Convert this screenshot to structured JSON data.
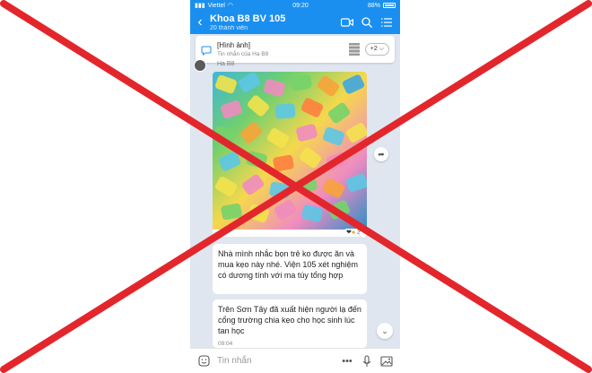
{
  "status": {
    "carrier": "Viettel",
    "time": "09:20",
    "battery": "88%"
  },
  "header": {
    "title": "Khoa B8 BV 105",
    "subtitle": "20 thành viên"
  },
  "pinned": {
    "title": "[Hình ảnh]",
    "sub": "Tin nhắn của Ha B8",
    "more": "+2 ⌵"
  },
  "message": {
    "sender": "Ha B8",
    "reactions": "3",
    "text1": "Nhà mình nhắc bọn trẻ ko được ăn và mua kẹo này nhé. Viện 105 xét nghiệm có dương tính với ma túy tổng hợp",
    "text2": "Trên Sơn Tây đã xuất hiện người lạ đến cổng trường chia kẹo cho học sinh lúc tan học",
    "time2": "09:04"
  },
  "input": {
    "placeholder": "Tin nhắn"
  },
  "colors": {
    "accent": "#1a8ff0",
    "overlay": "#e3262b"
  }
}
